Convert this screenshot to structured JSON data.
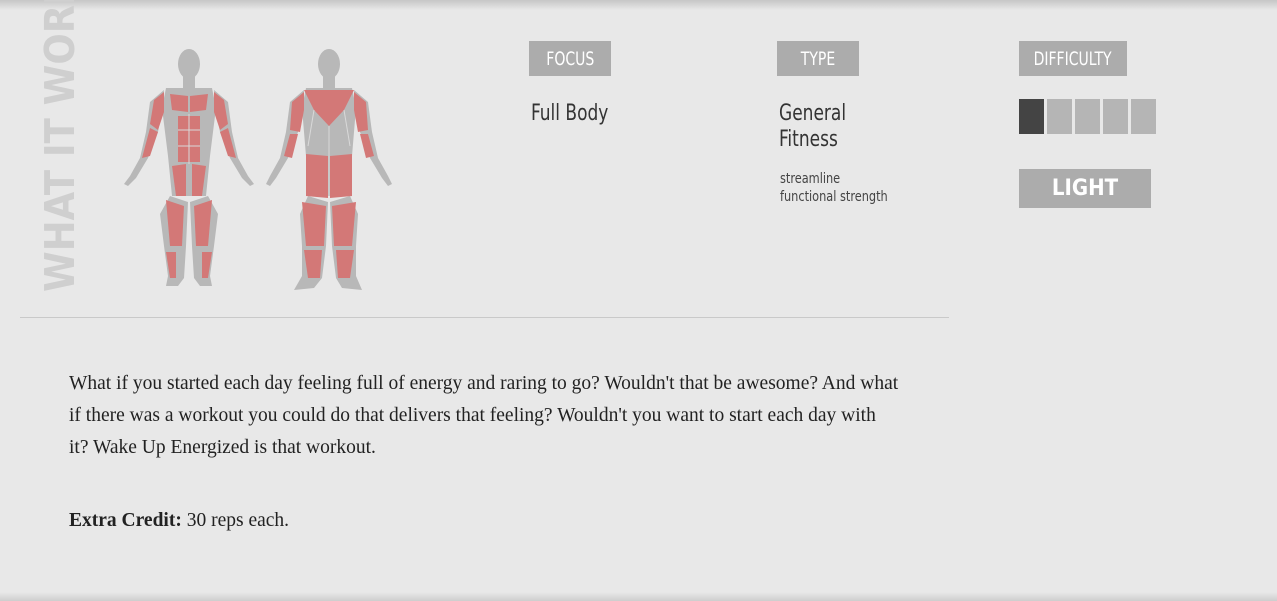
{
  "section": {
    "vertical_title": "WHAT IT WORKS"
  },
  "figures": {
    "front_icon": "muscle-map-front",
    "back_icon": "muscle-map-back",
    "highlight_color": "#d37877",
    "body_color": "#b6b6b6"
  },
  "focus": {
    "label": "FOCUS",
    "value": "Full Body"
  },
  "type": {
    "label": "TYPE",
    "value_line1": "General",
    "value_line2": "Fitness",
    "tags": [
      "streamline",
      "functional strength"
    ]
  },
  "difficulty": {
    "label": "DIFFICULTY",
    "level": 1,
    "max": 5,
    "level_text": "LIGHT"
  },
  "description": {
    "text": "What if you started each day feeling full of energy and raring to go? Wouldn't that be awesome? And what if there was a workout you could do that delivers that feeling? Wouldn't you want to start each day with it? Wake Up Energized is that workout.",
    "extra_label": "Extra Credit:",
    "extra_text": " 30 reps each."
  }
}
